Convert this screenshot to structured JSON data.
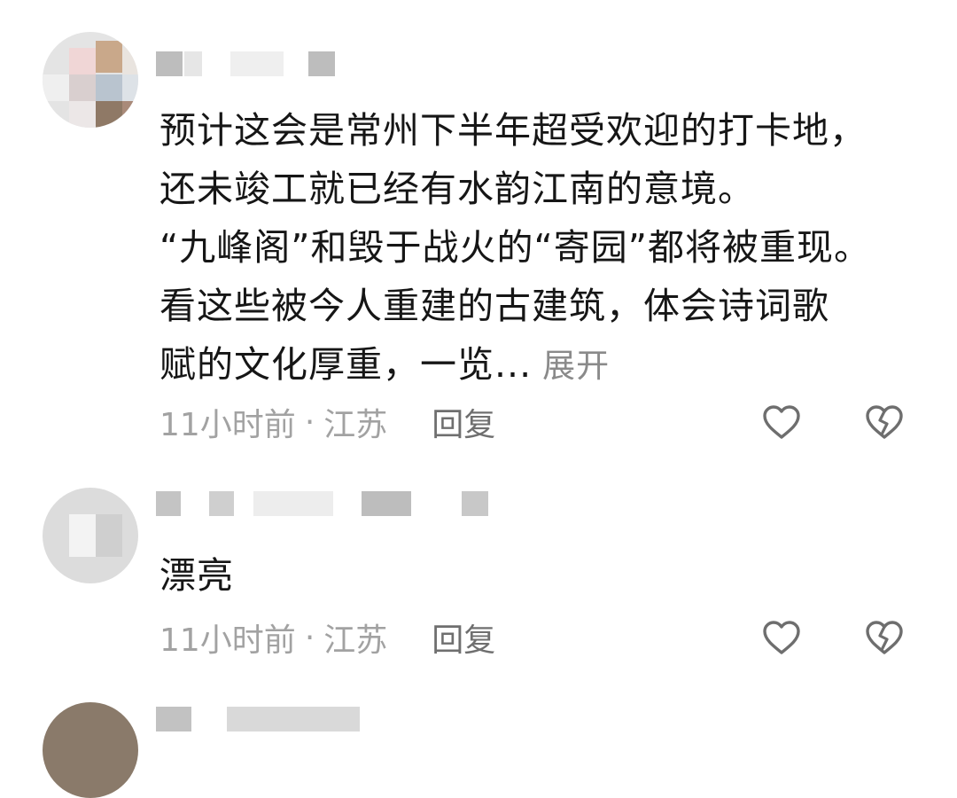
{
  "comments": [
    {
      "username": "",
      "text_lines": [
        "预计这会是常州下半年超受欢迎的打卡地，",
        "还未竣工就已经有水韵江南的意境。",
        "“九峰阁”和毁于战火的“寄园”都将被重现。",
        "看这些被今人重建的古建筑，体会诗词歌"
      ],
      "text_last": "赋的文化厚重，一览...",
      "expand_label": "展开",
      "time": "11小时前",
      "separator": "·",
      "location": "江苏",
      "reply_label": "回复",
      "like_icon": "heart-outline-icon",
      "dislike_icon": "broken-heart-icon"
    },
    {
      "username": "",
      "text": "漂亮",
      "time": "11小时前",
      "separator": "·",
      "location": "江苏",
      "reply_label": "回复",
      "like_icon": "heart-outline-icon",
      "dislike_icon": "broken-heart-icon"
    }
  ],
  "colors": {
    "text": "#161616",
    "meta": "#a2a2a2",
    "reply": "#6f6f6f",
    "expand": "#8a8a8a"
  }
}
